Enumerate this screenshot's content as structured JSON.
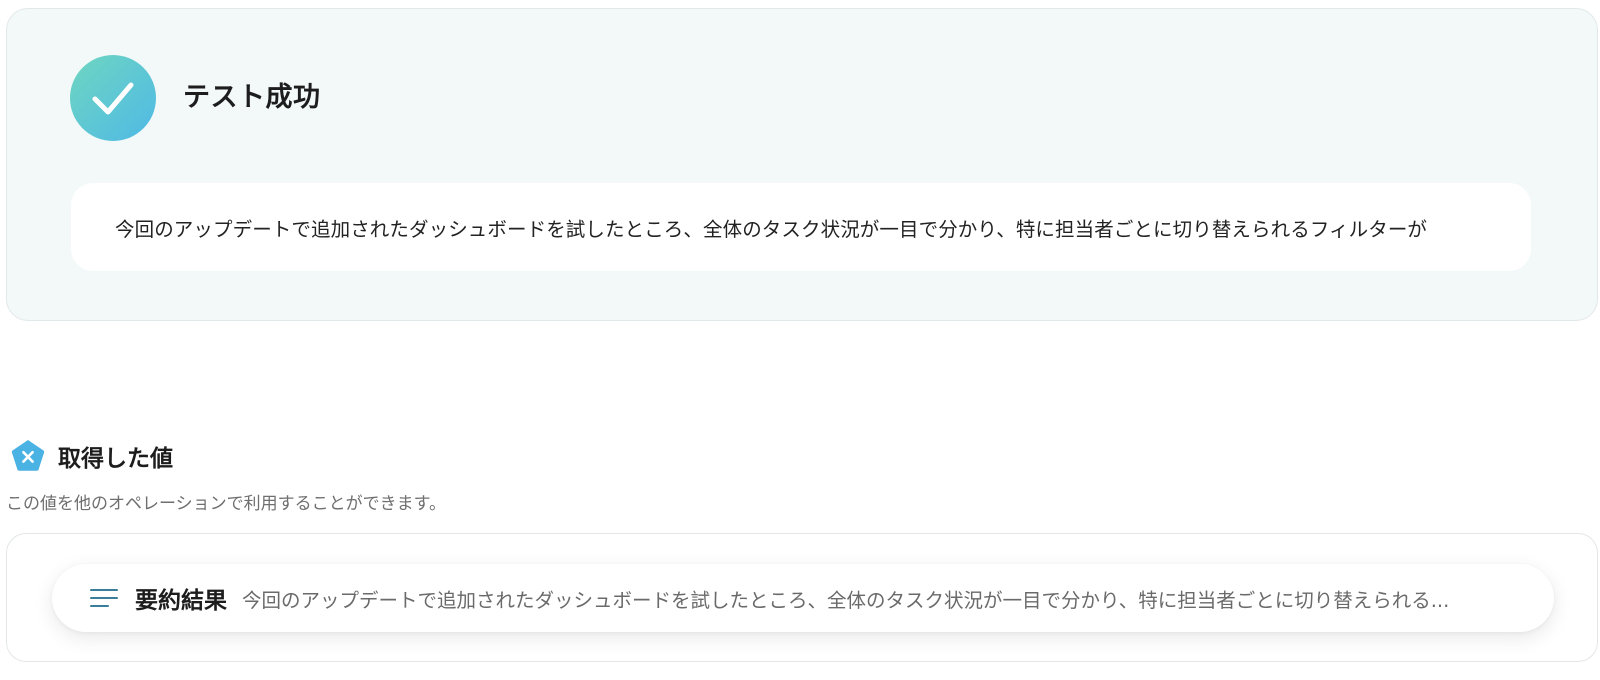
{
  "result": {
    "status_title": "テスト成功",
    "message": "今回のアップデートで追加されたダッシュボードを試したところ、全体のタスク状況が一目で分かり、特に担当者ごとに切り替えられるフィルターが",
    "icons": {
      "status": "check-circle-icon"
    },
    "colors": {
      "card_background": "#f3f9f9",
      "success_gradient_start": "#6fd6c0",
      "success_gradient_end": "#4fb9e6"
    }
  },
  "fetched_values": {
    "title": "取得した値",
    "description": "この値を他のオペレーションで利用することができます。",
    "icons": {
      "header": "variable-pentagon-icon",
      "item": "text-lines-icon"
    },
    "items": [
      {
        "label": "要約結果",
        "value": "今回のアップデートで追加されたダッシュボードを試したところ、全体のタスク状況が一目で分かり、特に担当者ごとに切り替えられる..."
      }
    ],
    "colors": {
      "accent": "#4ab3e3",
      "item_icon": "#3a7f99"
    }
  }
}
